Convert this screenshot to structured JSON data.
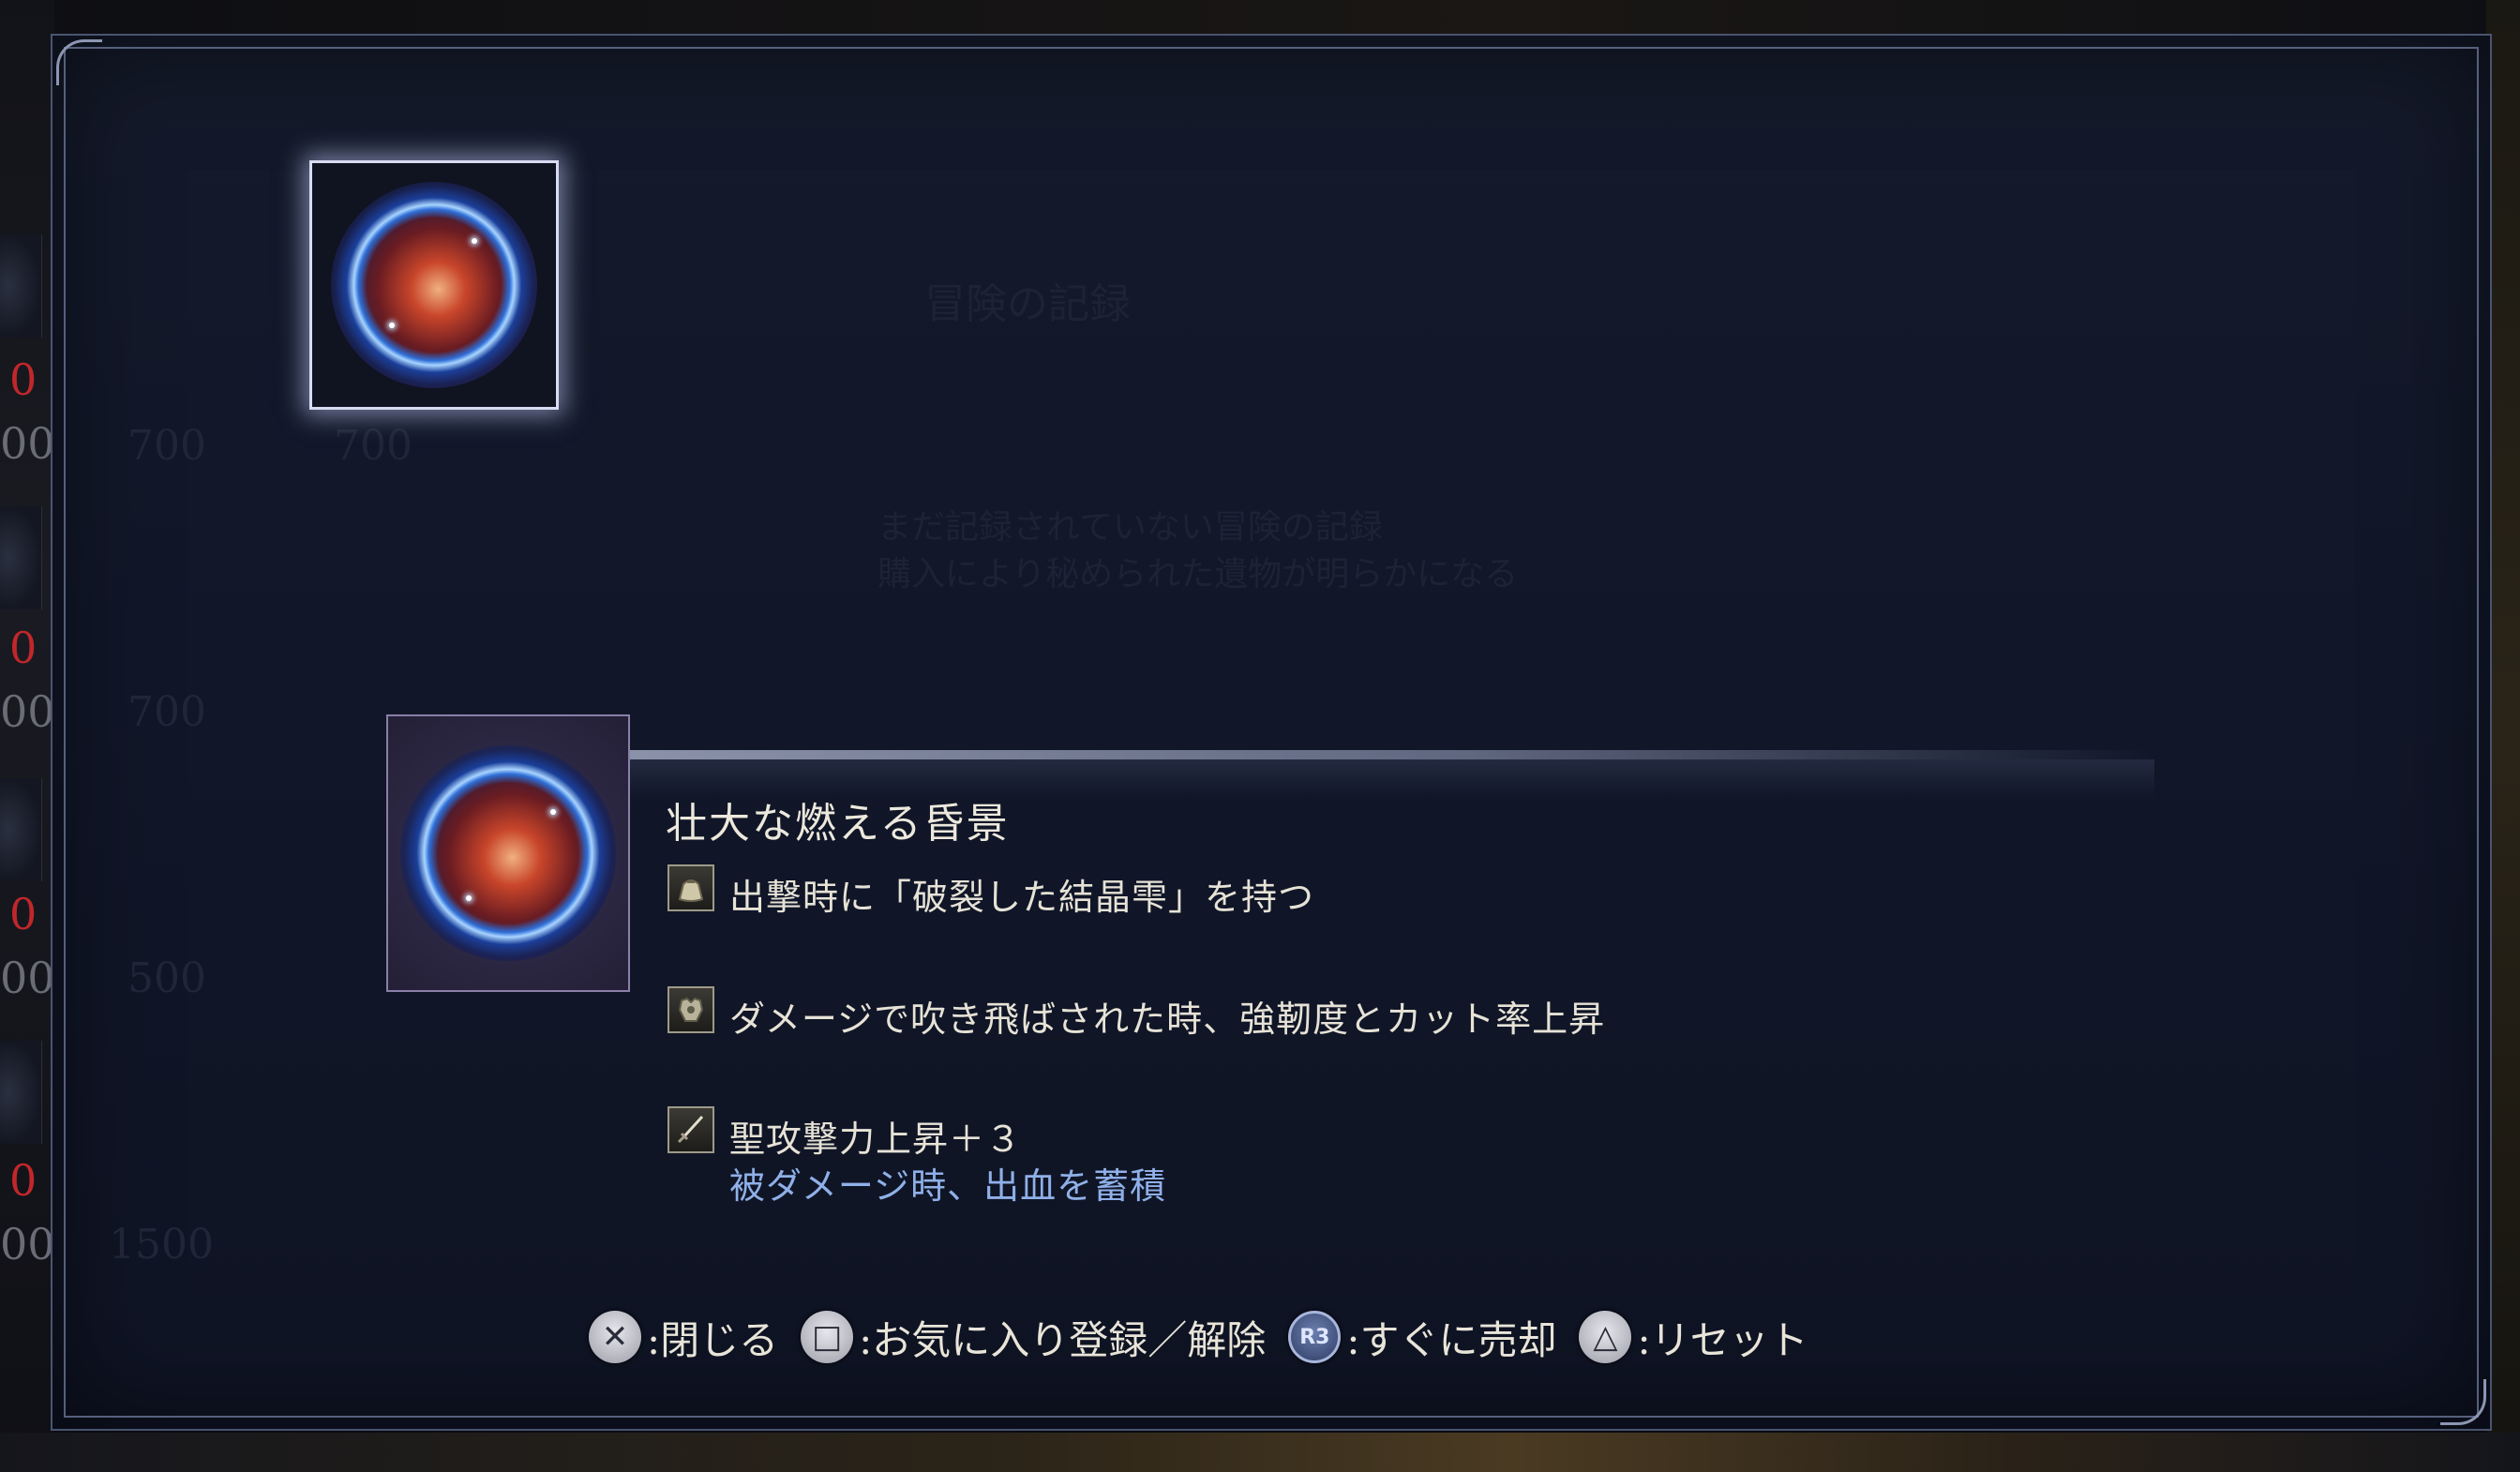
{
  "background": {
    "side_values": [
      "0",
      "0",
      "0",
      "0"
    ],
    "side_values2": [
      "00",
      "00",
      "00",
      "00"
    ]
  },
  "ghost_card": {
    "title": "冒険の記録",
    "description_line1": "まだ記録されていない冒険の記録",
    "description_line2": "購入により秘められた遺物が明らかになる",
    "prices": [
      "700",
      "700",
      "700",
      "500",
      "1500"
    ]
  },
  "item": {
    "name": "壮大な燃える昏景",
    "effects": [
      {
        "icon": "pouch-icon",
        "text": "出撃時に「破裂した結晶雫」を持つ",
        "sub": ""
      },
      {
        "icon": "armor-icon",
        "text": "ダメージで吹き飛ばされた時、強靭度とカット率上昇",
        "sub": ""
      },
      {
        "icon": "sword-icon",
        "text": "聖攻撃力上昇＋３",
        "sub": "被ダメージ時、出血を蓄積"
      }
    ]
  },
  "controls": {
    "close": {
      "glyph": "✕",
      "label": ":閉じる"
    },
    "favorite": {
      "glyph": "□",
      "label": ":お気に入り登録／解除"
    },
    "sell": {
      "glyph": "R3",
      "label": ":すぐに売却"
    },
    "reset": {
      "glyph": "△",
      "label": ":リセット"
    }
  },
  "colors": {
    "panel": "#111729",
    "accent_blue_text": "#8fb0e8",
    "name_text": "#ece8dc",
    "bg_red_value": "#c0272b"
  }
}
